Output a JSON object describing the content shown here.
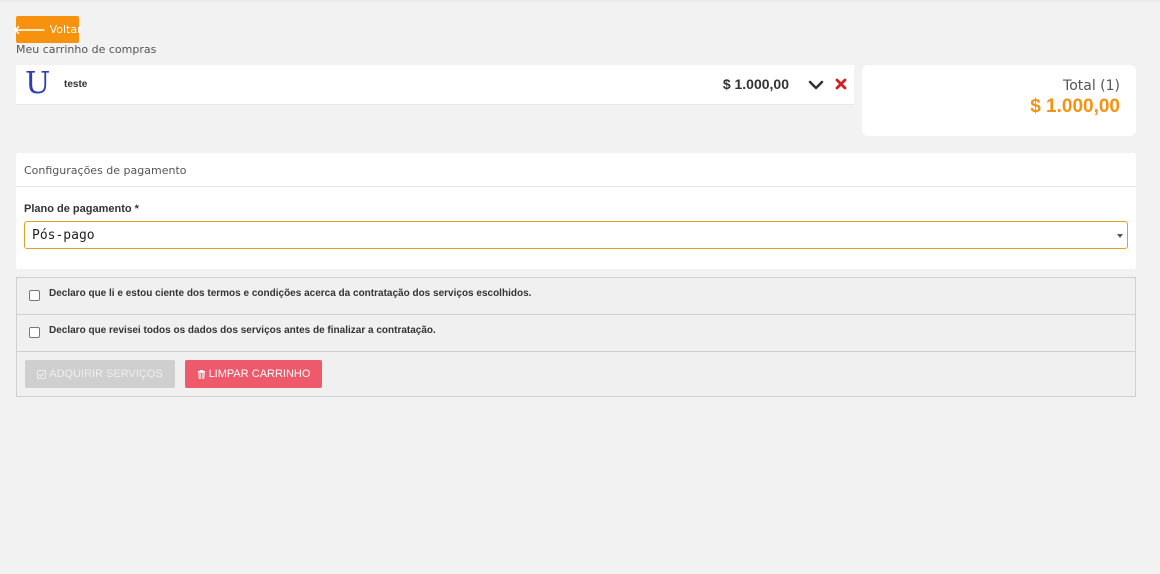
{
  "header": {
    "back_label": "Voltar",
    "cart_title": "Meu carrinho de compras"
  },
  "cart": {
    "items": [
      {
        "logo_letter": "U",
        "name": "teste",
        "price": "$ 1.000,00"
      }
    ]
  },
  "summary": {
    "total_label": "Total (1)",
    "total_value": "$ 1.000,00"
  },
  "payment": {
    "section_title": "Configurações de pagamento",
    "plan_label": "Plano de pagamento *",
    "plan_selected": "Pós-pago"
  },
  "terms": {
    "term_1": "Declaro que li e estou ciente dos termos e condições acerca da contratação dos serviços escolhidos.",
    "term_2": "Declaro que revisei todos os dados dos serviços antes de finalizar a contratação."
  },
  "actions": {
    "buy_label": "ADQUIRIR SERVIÇOS",
    "clear_label": "LIMPAR CARRINHO"
  },
  "colors": {
    "accent": "#f7920f",
    "danger": "#ee5a6b",
    "disabled": "#cfcfcf"
  },
  "icons": {
    "back": "arrow-left-icon",
    "expand": "chevron-down-icon",
    "remove": "close-icon",
    "buy": "check-square-icon",
    "clear": "trash-icon"
  }
}
